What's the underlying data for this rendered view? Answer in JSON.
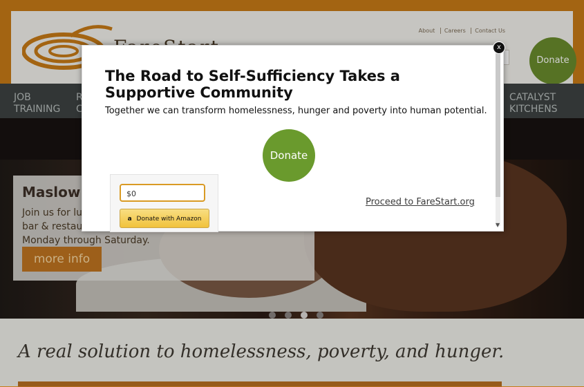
{
  "header": {
    "logo_text": "FareStart",
    "links": [
      "About",
      "Careers",
      "Contact Us"
    ],
    "donate_label": "Donate"
  },
  "nav": {
    "items": [
      {
        "label_line1": "JOB",
        "label_line2": "TRAINING"
      },
      {
        "label_line1": "R",
        "label_line2": "C"
      },
      {
        "label_line1": "CATALYST",
        "label_line2": "KITCHENS"
      }
    ]
  },
  "slide": {
    "title": "Maslow's",
    "text": "Join us for lun\nbar & restaur\nMonday through Saturday.",
    "button": "more info"
  },
  "slider": {
    "dots": 4,
    "active_index": 2
  },
  "tagline": "A real solution to homelessness, poverty, and hunger.",
  "modal": {
    "title": "The Road to Self-Sufficiency Takes a Supportive Community",
    "subtitle": "Together we can transform homelessness, hunger and poverty into human potential.",
    "donate_label": "Donate",
    "amount_value": "$0",
    "amazon_button": "Donate with Amazon",
    "proceed_link": "Proceed to FareStart.org",
    "close_label": "x"
  },
  "colors": {
    "brand_orange": "#c77a17",
    "donate_green": "#6a9a2d",
    "nav_bg": "#3d4342"
  }
}
